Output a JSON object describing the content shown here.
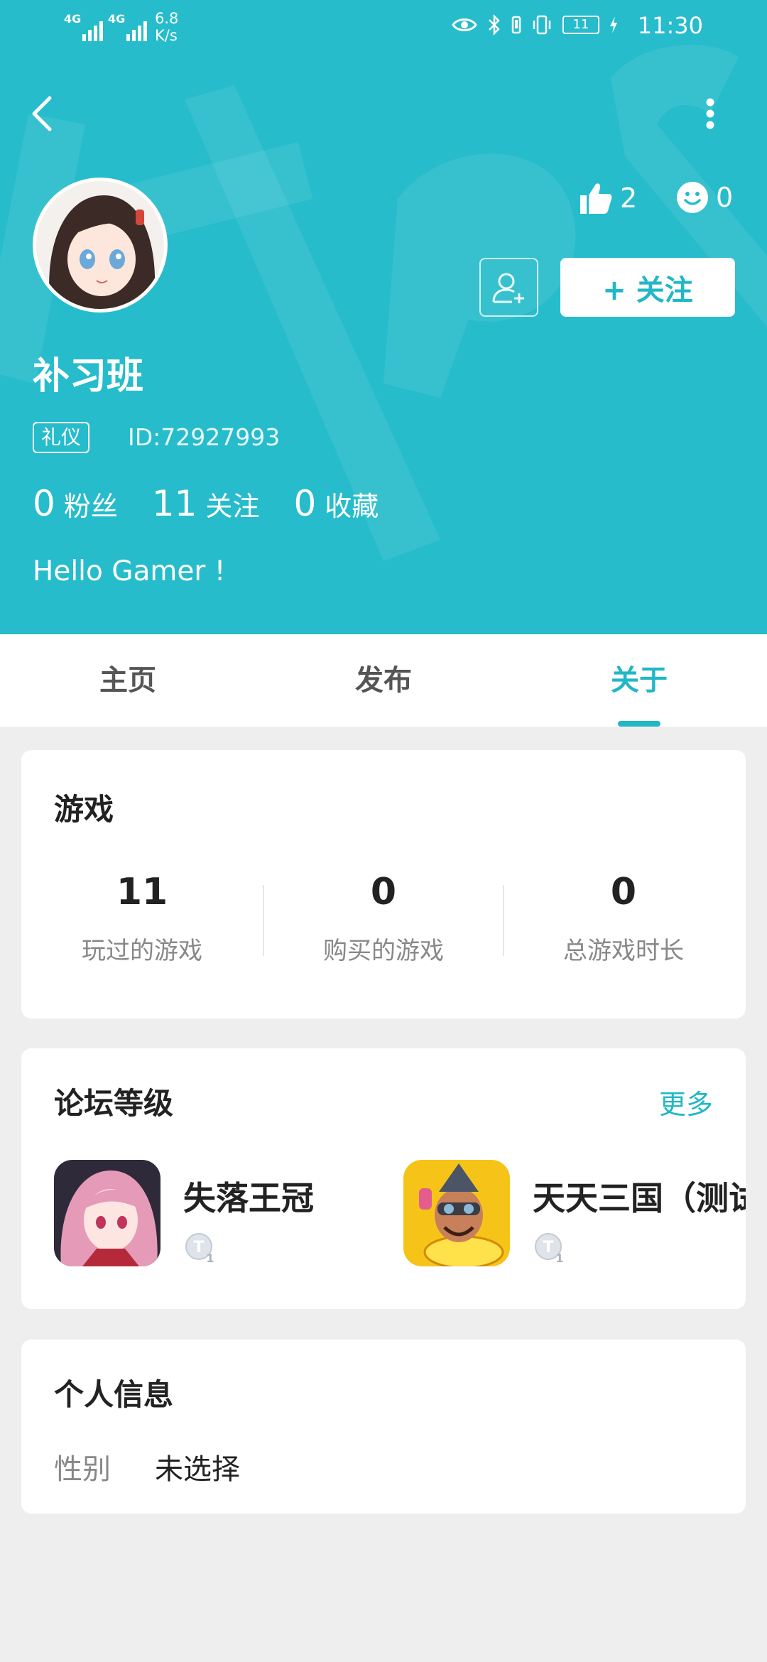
{
  "status_bar": {
    "net_type_1": "4G",
    "net_type_2": "4G",
    "net_speed": "6.8",
    "net_speed_unit": "K/s",
    "battery": "11",
    "time": "11:30"
  },
  "profile": {
    "username": "补习班",
    "tag": "礼仪",
    "user_id": "ID:72927993",
    "likes": "2",
    "emoji_count": "0",
    "follow_label": "+ 关注",
    "stats": [
      {
        "num": "0",
        "label": "粉丝"
      },
      {
        "num": "11",
        "label": "关注"
      },
      {
        "num": "0",
        "label": "收藏"
      }
    ],
    "bio": "Hello Gamer !"
  },
  "tabs": [
    {
      "label": "主页"
    },
    {
      "label": "发布"
    },
    {
      "label": "关于"
    }
  ],
  "games_card": {
    "title": "游戏",
    "stats": [
      {
        "num": "11",
        "label": "玩过的游戏"
      },
      {
        "num": "0",
        "label": "购买的游戏"
      },
      {
        "num": "0",
        "label": "总游戏时长"
      }
    ]
  },
  "forum_card": {
    "title": "论坛等级",
    "more": "更多",
    "items": [
      {
        "name": "失落王冠",
        "level": "1"
      },
      {
        "name": "天天三国（测试",
        "level": "1"
      }
    ]
  },
  "personal_card": {
    "title": "个人信息",
    "rows": [
      {
        "label": "性别",
        "value": "未选择"
      }
    ]
  },
  "colors": {
    "header": "#26bccb",
    "accent": "#21b7c6"
  }
}
